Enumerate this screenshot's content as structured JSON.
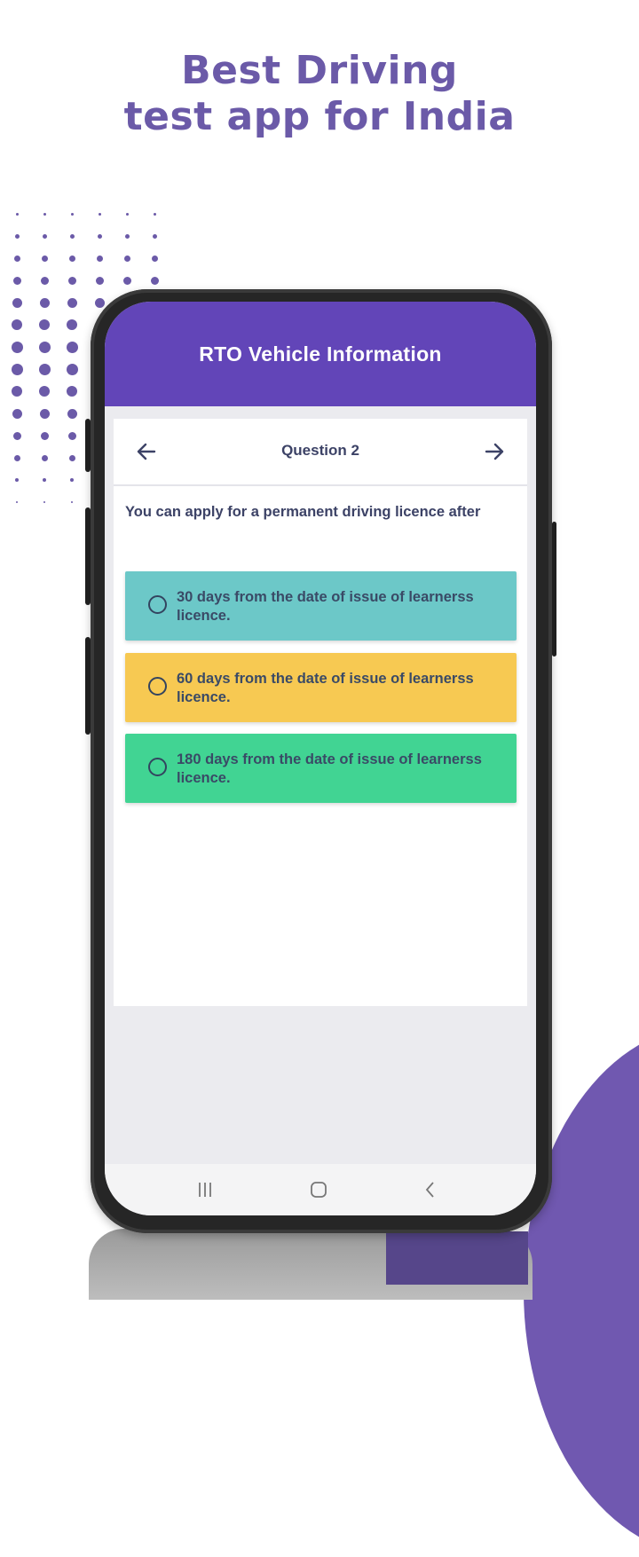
{
  "headline": {
    "line1": "Best Driving",
    "line2": "test app for India"
  },
  "colors": {
    "brand_purple": "#6b5aa8",
    "appbar": "#6245b8",
    "option_teal": "#6cc8c8",
    "option_yellow": "#f7c952",
    "option_green": "#41d493",
    "text_dark": "#3c4266"
  },
  "app": {
    "title": "RTO Vehicle Information",
    "nav": {
      "prev_icon": "arrow-left-icon",
      "title": "Question 2",
      "next_icon": "arrow-right-icon"
    },
    "question": "You can apply for a permanent driving licence after",
    "options": [
      {
        "label": "30 days from the date of issue of learnerss licence.",
        "color": "#6cc8c8",
        "icon": "radio-unchecked-icon"
      },
      {
        "label": "60 days from the date of issue of learnerss licence.",
        "color": "#f7c952",
        "icon": "radio-unchecked-icon"
      },
      {
        "label": "180 days from the date of issue of learnerss licence.",
        "color": "#41d493",
        "icon": "radio-unchecked-icon"
      }
    ]
  },
  "system_nav": {
    "recents_icon": "recents-icon",
    "home_icon": "home-icon",
    "back_icon": "back-icon"
  }
}
